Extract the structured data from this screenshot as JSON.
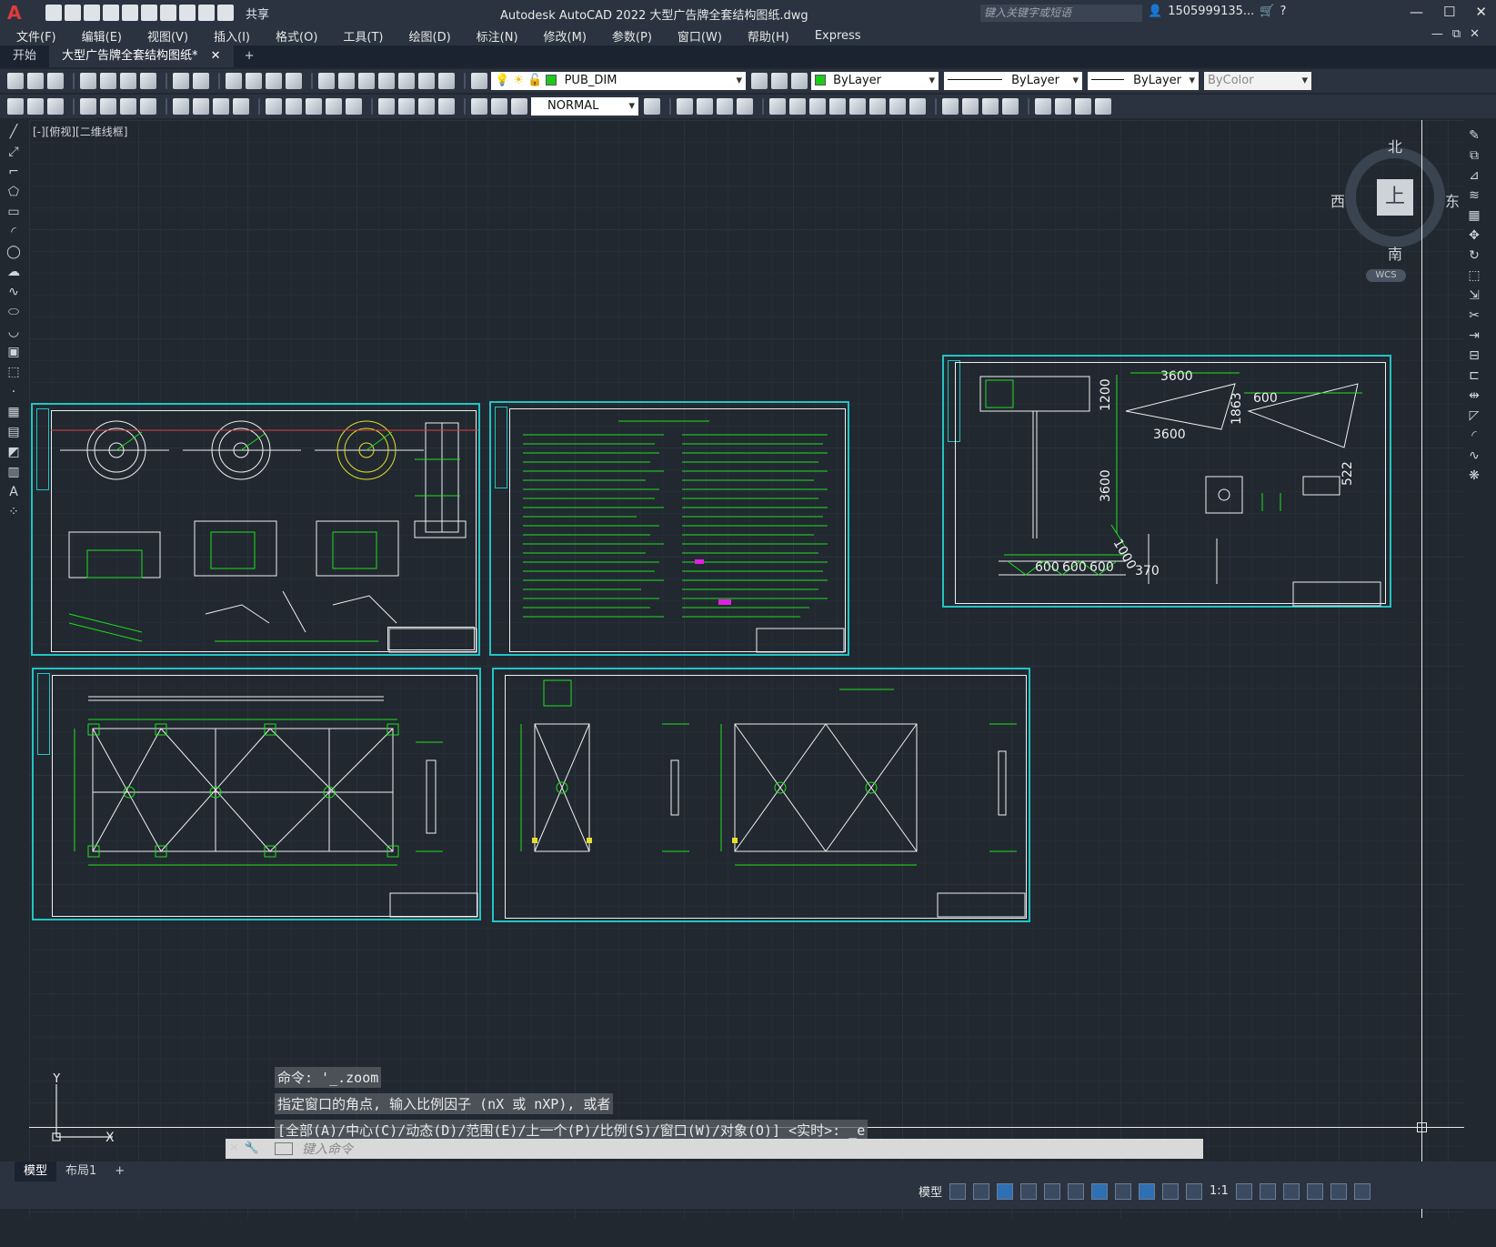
{
  "app": {
    "logo": "A",
    "title": "Autodesk AutoCAD 2022    大型广告牌全套结构图纸.dwg",
    "share_label": "共享",
    "search_placeholder": "键入关键字或短语",
    "user": "1505999135...",
    "window_buttons": [
      "—",
      "☐",
      "✕"
    ]
  },
  "menu": [
    "文件(F)",
    "编辑(E)",
    "视图(V)",
    "插入(I)",
    "格式(O)",
    "工具(T)",
    "绘图(D)",
    "标注(N)",
    "修改(M)",
    "参数(P)",
    "窗口(W)",
    "帮助(H)",
    "Express"
  ],
  "menu_right_buttons": "—⧉✕",
  "tabs": [
    {
      "label": "开始",
      "active": false
    },
    {
      "label": "大型广告牌全套结构图纸*",
      "active": true
    }
  ],
  "tab_close": "✕",
  "tab_add": "+",
  "toolbar1": {
    "layer_name": "PUB_DIM",
    "color": "ByLayer",
    "linetype": "ByLayer",
    "lineweight": "ByLayer",
    "plotstyle": "ByColor"
  },
  "toolbar2": {
    "text_style": "NORMAL"
  },
  "viewport_label": "[-][俯视][二维线框]",
  "viewcube": {
    "north": "北",
    "south": "南",
    "east": "东",
    "west": "西",
    "face": "上",
    "wcs": "WCS"
  },
  "ucs": {
    "x": "X",
    "y": "Y"
  },
  "command_history": [
    "命令: '_.zoom",
    "指定窗口的角点, 输入比例因子 (nX 或 nXP), 或者",
    "[全部(A)/中心(C)/动态(D)/范围(E)/上一个(P)/比例(S)/窗口(W)/对象(O)] <实时>: _e"
  ],
  "command_placeholder": "键入命令",
  "command_left_icons": [
    "✕",
    "🔧"
  ],
  "layout_tabs": [
    {
      "label": "模型",
      "active": true
    },
    {
      "label": "布局1",
      "active": false
    }
  ],
  "layout_add": "+",
  "status": {
    "model_label": "模型",
    "scale": "1:1"
  },
  "sheets": {
    "s3_dims": [
      "3600",
      "3600",
      "1863",
      "1200",
      "3600",
      "1000",
      "600",
      "600",
      "600",
      "600",
      "370",
      "522"
    ]
  },
  "colors": {
    "sheet_border": "#22c4c4",
    "drawing_green": "#1ee01e",
    "drawing_white": "#f0f0f0",
    "drawing_yellow": "#e6e02a",
    "accent_blue": "#2f6fb3"
  }
}
